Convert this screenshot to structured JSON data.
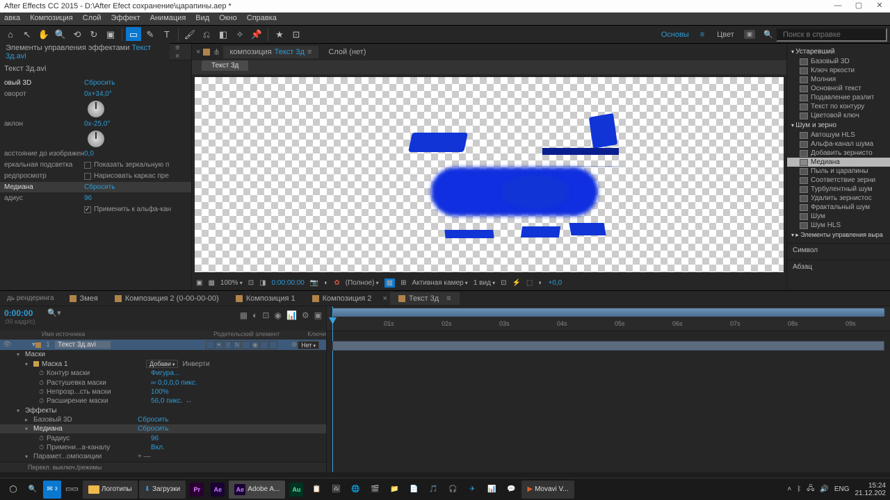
{
  "title_bar": "After Effects CC 2015 - D:\\After Efect сохранение\\царапины.aep *",
  "menu": [
    "авка",
    "Композиция",
    "Слой",
    "Эффект",
    "Анимация",
    "Вид",
    "Окно",
    "Справка"
  ],
  "workspace": {
    "main": "Основы",
    "color": "Цвет",
    "search_ph": "Поиск в справке"
  },
  "effects_panel": {
    "tab_label": "Элементы управления эффектами",
    "tab_link": "Текст 3д.avi",
    "layer_title": "Текст 3д.avi",
    "fx1_name": "овый 3D",
    "fx1_reset": "Сбросить",
    "rot_label": "оворот",
    "rot_val": "0х+34,0°",
    "tilt_label": "аклон",
    "tilt_val": "0х-25,0°",
    "dist_label": "асстояние до изображени",
    "dist_val": "0,0",
    "spec_label": "еркальная подсветка",
    "spec_opt": "Показать зеркальную п",
    "prev_label": "редпросмотр",
    "prev_opt": "Нарисовать каркас пре",
    "fx2_name": "Медиана",
    "fx2_reset": "Сбросить",
    "radius_label": "адиус",
    "radius_val": "96",
    "alpha_opt": "Применить к альфа-кан"
  },
  "comp_tabs": {
    "comp_label": "композиция",
    "comp_link": "Текст 3д",
    "layer_label": "Слой (нет)",
    "subtab": "Текст 3д"
  },
  "viewer_bar": {
    "zoom": "100%",
    "time": "0:00:00:00",
    "res": "(Полное)",
    "cam": "Активная камер",
    "views": "1 вид",
    "exp": "+0,0"
  },
  "right_panel": {
    "g1": "Устаревший",
    "g1_items": [
      "Базовый 3D",
      "Ключ яркости",
      "Молния",
      "Основной текст",
      "Подавление разлит",
      "Текст по контуру",
      "Цветовой ключ"
    ],
    "g2": "Шум и зерно",
    "g2_items": [
      "Автошум HLS",
      "Альфа-канал шума",
      "Добавить зернисто",
      "Медиана",
      "Пыль и царапины",
      "Соответствие зерни",
      "Турбулентный шум",
      "Удалить зернистос",
      "Фрактальный шум",
      "Шум",
      "Шум HLS"
    ],
    "g3": "Элементы управления выра",
    "sec1": "Символ",
    "sec2": "Абзац"
  },
  "tl_tabs": {
    "render": "дь рендеринга",
    "t1": "Змея",
    "t2": "Композиция 2 (0-00-00-00)",
    "t3": "Композиция 1",
    "t4": "Композиция 2",
    "t5": "Текст 3д"
  },
  "tl_header": {
    "tc": "0:00:00",
    "fps": ";00 кадр/с)",
    "col_src": "Имя источника",
    "col_parent": "Родительский элемент",
    "col_keys": "Ключи"
  },
  "layer": {
    "num": "1",
    "name": "Текст 3д.avi",
    "mode_none": "Нет",
    "masks": "Маски",
    "mask1": "Маска 1",
    "mask_mode": "Добави",
    "mask_inv": "Инверти",
    "p_path": "Контур маски",
    "v_path": "Фигура...",
    "p_feather": "Растушевка маски",
    "v_feather": "∞ 0,0,0,0 пикс.",
    "p_opac": "Непрозр...сть маски",
    "v_opac": "100%",
    "p_exp": "Расширение маски",
    "v_exp": "56,0 пикс.",
    "effects": "Эффекты",
    "e1": "Базовый 3D",
    "e1r": "Сбросить",
    "e2": "Медиана",
    "e2r": "Сбросить",
    "e2_rad": "Радиус",
    "e2_rad_v": "96",
    "e2_alpha": "Примени...а-каналу",
    "e2_alpha_v": "Вкл.",
    "comp_opts": "Парамет...омпозиции",
    "footer": "Перекл. выключ./режимы"
  },
  "ruler": [
    "01s",
    "02s",
    "03s",
    "04s",
    "05s",
    "06s",
    "07s",
    "08s",
    "09s"
  ],
  "taskbar": {
    "f1": "Логотипы",
    "f2": "Загрузки",
    "app": "Adobe A...",
    "mv": "Movavi V...",
    "lang": "ENG",
    "time": "15:24",
    "date": "21.12.202"
  }
}
